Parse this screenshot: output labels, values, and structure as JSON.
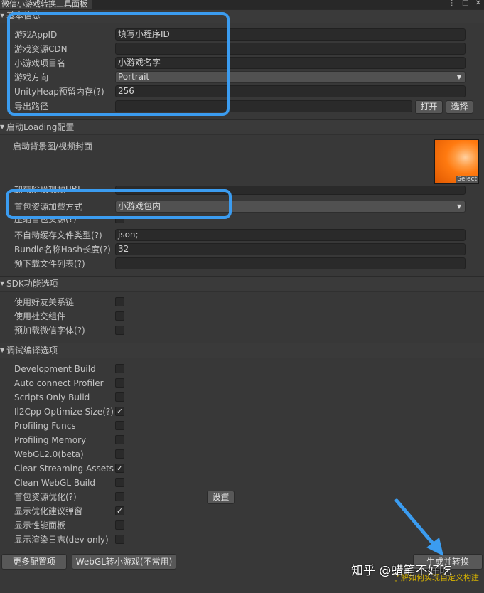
{
  "window": {
    "title": "微信小游戏转换工具面板",
    "controls": {
      "menu": "⋮",
      "maximize": "□",
      "close": "✕"
    }
  },
  "sections": {
    "basic": {
      "header": "基本信息",
      "appid_label": "游戏AppID",
      "appid_value": "填写小程序ID",
      "cdn_label": "游戏资源CDN",
      "cdn_value": "",
      "project_label": "小游戏项目名",
      "project_value": "小游戏名字",
      "orientation_label": "游戏方向",
      "orientation_value": "Portrait",
      "heap_label": "UnityHeap预留内存(?)",
      "heap_value": "256",
      "export_label": "导出路径",
      "export_value": "",
      "open_button": "打开",
      "choose_button": "选择"
    },
    "loading": {
      "header": "启动Loading配置",
      "bg_label": "启动背景图/视频封面",
      "select_label": "Select",
      "video_label": "加载阶段视频URL",
      "video_value": "",
      "load_method_label": "首包资源加载方式",
      "load_method_value": "小游戏包内",
      "compress_label": "压缩首包资源(?)",
      "nocache_label": "不自动缓存文件类型(?)",
      "nocache_value": "json;",
      "hash_label": "Bundle名称Hash长度(?)",
      "hash_value": "32",
      "preload_label": "预下载文件列表(?)",
      "preload_value": ""
    },
    "sdk": {
      "header": "SDK功能选项",
      "items": [
        {
          "label": "使用好友关系链",
          "checked": false
        },
        {
          "label": "使用社交组件",
          "checked": false
        },
        {
          "label": "预加载微信字体(?)",
          "checked": false
        }
      ]
    },
    "debug": {
      "header": "调试编译选项",
      "items": [
        {
          "label": "Development Build",
          "checked": false
        },
        {
          "label": "Auto connect Profiler",
          "checked": false
        },
        {
          "label": "Scripts Only Build",
          "checked": false
        },
        {
          "label": "Il2Cpp Optimize Size(?)",
          "checked": true
        },
        {
          "label": "Profiling Funcs",
          "checked": false
        },
        {
          "label": "Profiling Memory",
          "checked": false
        },
        {
          "label": "WebGL2.0(beta)",
          "checked": false
        },
        {
          "label": "Clear Streaming Assets",
          "checked": true
        },
        {
          "label": "Clean WebGL Build",
          "checked": false
        },
        {
          "label": "首包资源优化(?)",
          "checked": false
        },
        {
          "label": "显示优化建议弹窗",
          "checked": true
        },
        {
          "label": "显示性能面板",
          "checked": false
        },
        {
          "label": "显示渲染日志(dev only)",
          "checked": false
        }
      ],
      "settings_button": "设置"
    }
  },
  "footer": {
    "more_button": "更多配置项",
    "webgl_button": "WebGL转小游戏(不常用)",
    "build_button": "生成并转换",
    "hint": "了解如何实现自定义构建"
  },
  "watermark": "知乎 @蜡笔不好吃",
  "colors": {
    "annotation": "#3b9cf0",
    "background": "#383838"
  }
}
